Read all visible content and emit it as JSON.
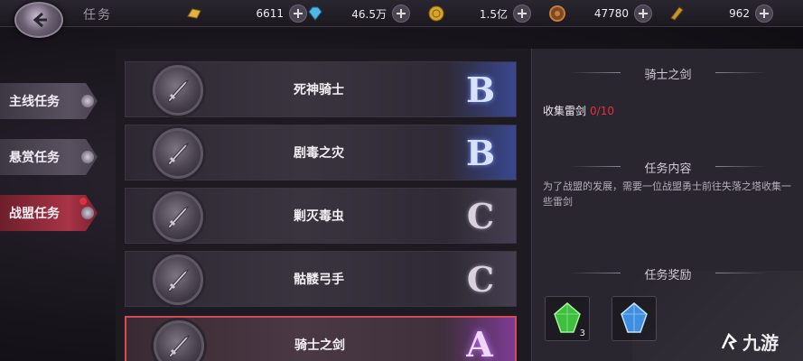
{
  "header": {
    "title": "任务",
    "resources": [
      {
        "icon": "gold-bar-icon",
        "value": "6611",
        "color": "#e0b340"
      },
      {
        "icon": "blue-diamond-icon",
        "value": "46.5万",
        "color": "#4fb6e8"
      },
      {
        "icon": "gold-coin-icon",
        "value": "1.5亿",
        "color": "#d8a52c"
      },
      {
        "icon": "bronze-medal-icon",
        "value": "47780",
        "color": "#c87b3a"
      },
      {
        "icon": "scroll-token-icon",
        "value": "962",
        "color": "#c9952f"
      }
    ]
  },
  "sidebar": {
    "tabs": [
      {
        "label": "主线任务",
        "active": false
      },
      {
        "label": "悬赏任务",
        "active": false
      },
      {
        "label": "战盟任务",
        "active": true,
        "badge": true
      }
    ]
  },
  "quests": [
    {
      "name": "死神骑士",
      "grade": "B"
    },
    {
      "name": "剧毒之灾",
      "grade": "B"
    },
    {
      "name": "剿灭毒虫",
      "grade": "C"
    },
    {
      "name": "骷髅弓手",
      "grade": "C"
    },
    {
      "name": "骑士之剑",
      "grade": "A",
      "selected": true
    }
  ],
  "detail": {
    "title": "骑士之剑",
    "objective": "收集雷剑",
    "progress": "0/10",
    "content_heading": "任务内容",
    "description": "为了战盟的发展，需要一位战盟勇士前往失落之塔收集一些雷剑",
    "reward_heading": "任务奖励",
    "rewards": [
      {
        "icon": "green-crystal-icon",
        "count": "3"
      },
      {
        "icon": "blue-crystal-icon",
        "count": ""
      }
    ]
  },
  "watermark": "九游",
  "colors": {
    "progress_red": "#e3323c",
    "active_tab": "#a83445",
    "grade_a": "#c47bff",
    "grade_b": "#6f8cff"
  }
}
